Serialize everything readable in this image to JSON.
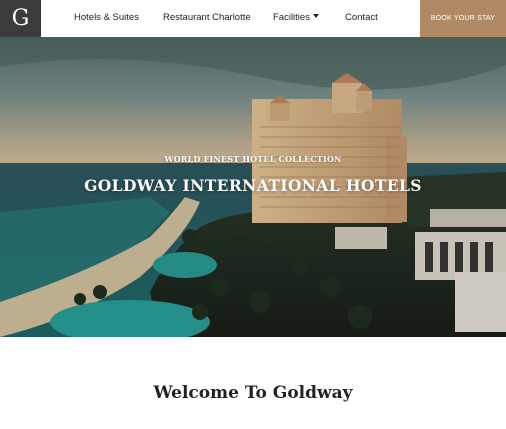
{
  "header": {
    "logo_letter": "G",
    "nav_items": [
      "Hotels & Suites",
      "Restaurant Charlotte",
      "Facilities",
      "Contact"
    ],
    "cta_label": "BOOK YOUR STAY"
  },
  "hero": {
    "subtitle": "WORLD FINEST HOTEL COLLECTION",
    "title": "GOLDWAY INTERNATIONAL HOTELS"
  },
  "welcome": {
    "heading": "Welcome To Goldway"
  },
  "colors": {
    "logo_bg": "#3b3b3b",
    "cta_bg": "#b08a64",
    "text": "#222222"
  }
}
